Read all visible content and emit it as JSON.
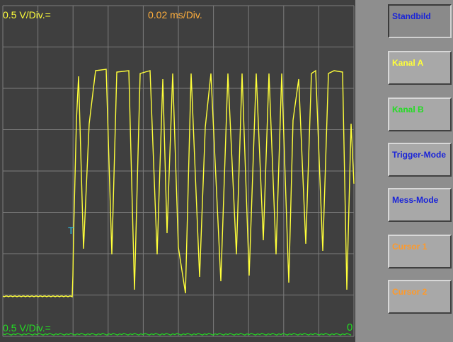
{
  "scope": {
    "channel_a_scale": "0.5 V/Div.=",
    "time_scale": "0.02 ms/Div.",
    "channel_b_scale": "0.5 V/Div.=",
    "ground_marker": "0",
    "trigger_marker": "T",
    "colors": {
      "channel_a": "#ffff3a",
      "channel_b": "#22dd22",
      "time": "#ffae3c",
      "trigger": "#2ec4e8",
      "grid": "#7c7c7c"
    }
  },
  "buttons": [
    {
      "label": "Standbild",
      "color": "#1a24d8",
      "state": "pressed"
    },
    {
      "label": "Kanal A",
      "color": "#ffff3a",
      "state": "normal"
    },
    {
      "label": "Kanal B",
      "color": "#22dd22",
      "state": "normal"
    },
    {
      "label": "Trigger-Mode",
      "color": "#1a24d8",
      "state": "normal"
    },
    {
      "label": "Mess-Mode",
      "color": "#1a24d8",
      "state": "normal"
    },
    {
      "label": "Cursor 1",
      "color": "#ff9a2a",
      "state": "normal"
    },
    {
      "label": "Cursor 2",
      "color": "#ff9a2a",
      "state": "normal"
    }
  ]
}
